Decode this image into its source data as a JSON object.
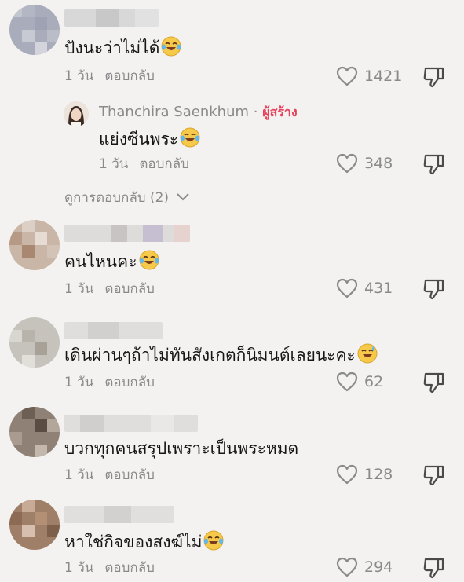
{
  "comments": [
    {
      "text": "ปังนะว่าไม่ได้",
      "time": "1 วัน",
      "reply_label": "ตอบกลับ",
      "likes": "1421",
      "has_emoji": true
    },
    {
      "text": "คนไหนคะ",
      "time": "1 วัน",
      "reply_label": "ตอบกลับ",
      "likes": "431",
      "has_emoji": true
    },
    {
      "text": "เดินผ่านๆถ้าไม่ทันสังเกตก็นิมนต์เลยนะคะ",
      "time": "1 วัน",
      "reply_label": "ตอบกลับ",
      "likes": "62",
      "has_emoji": true
    },
    {
      "text": "บวกทุกคนสรุปเพราะเป็นพระหมด",
      "time": "1 วัน",
      "reply_label": "ตอบกลับ",
      "likes": "128",
      "has_emoji": false
    },
    {
      "text": "หาใช่กิจของสงฆ์ไม่",
      "time": "1 วัน",
      "reply_label": "ตอบกลับ",
      "likes": "294",
      "has_emoji": true
    }
  ],
  "creator_reply": {
    "name": "Thanchira Saenkhum",
    "separator": " · ",
    "badge": "ผู้สร้าง",
    "text": "แย่งซีนพระ",
    "time": "1 วัน",
    "reply_label": "ตอบกลับ",
    "likes": "348"
  },
  "view_replies": "ดูการตอบกลับ (2)",
  "colors": {
    "background": "#f3f2f1",
    "text": "#161616",
    "muted": "#8a8a8a",
    "creator_badge": "#e8405b"
  },
  "icons": [
    "heart-outline-icon",
    "dislike-icon",
    "laugh-tears-emoji",
    "sweat-smile-emoji",
    "chevron-down-icon"
  ]
}
